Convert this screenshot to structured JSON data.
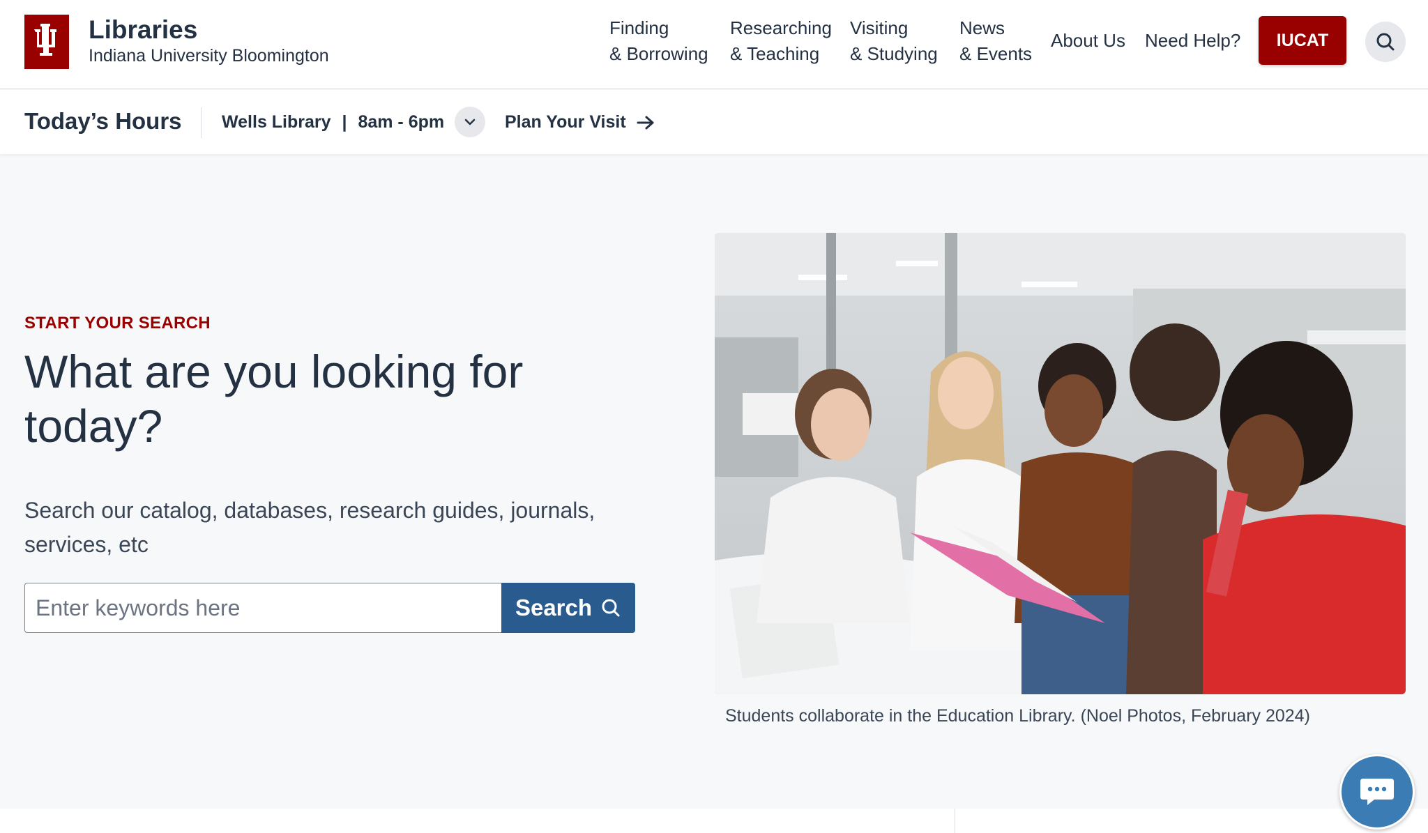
{
  "brand": {
    "title": "Libraries",
    "subtitle": "Indiana University Bloomington",
    "logo_icon": "iu-trident-icon",
    "brand_color": "#990000"
  },
  "nav": {
    "items": [
      {
        "line1": "Finding",
        "line2": "& Borrowing"
      },
      {
        "line1": "Researching",
        "line2": "& Teaching"
      },
      {
        "line1": "Visiting",
        "line2": "& Studying"
      },
      {
        "line1": "News",
        "line2": "& Events"
      }
    ],
    "about": "About Us",
    "help": "Need Help?",
    "iucat": "IUCAT",
    "search_icon": "search-icon"
  },
  "hours": {
    "title": "Today’s Hours",
    "location": "Wells Library",
    "separator": "|",
    "time": "8am - 6pm",
    "plan_visit": "Plan Your Visit"
  },
  "hero": {
    "eyebrow": "START YOUR SEARCH",
    "headline": "What are you looking for today?",
    "lead": "Search our catalog, databases, research guides, journals, services, etc",
    "search_placeholder": "Enter keywords here",
    "search_button": "Search",
    "accent": "#2a5b8e",
    "caption": "Students collaborate in the Education Library. (Noel Photos, February 2024)"
  },
  "chat": {
    "icon": "chat-bubble-icon"
  }
}
